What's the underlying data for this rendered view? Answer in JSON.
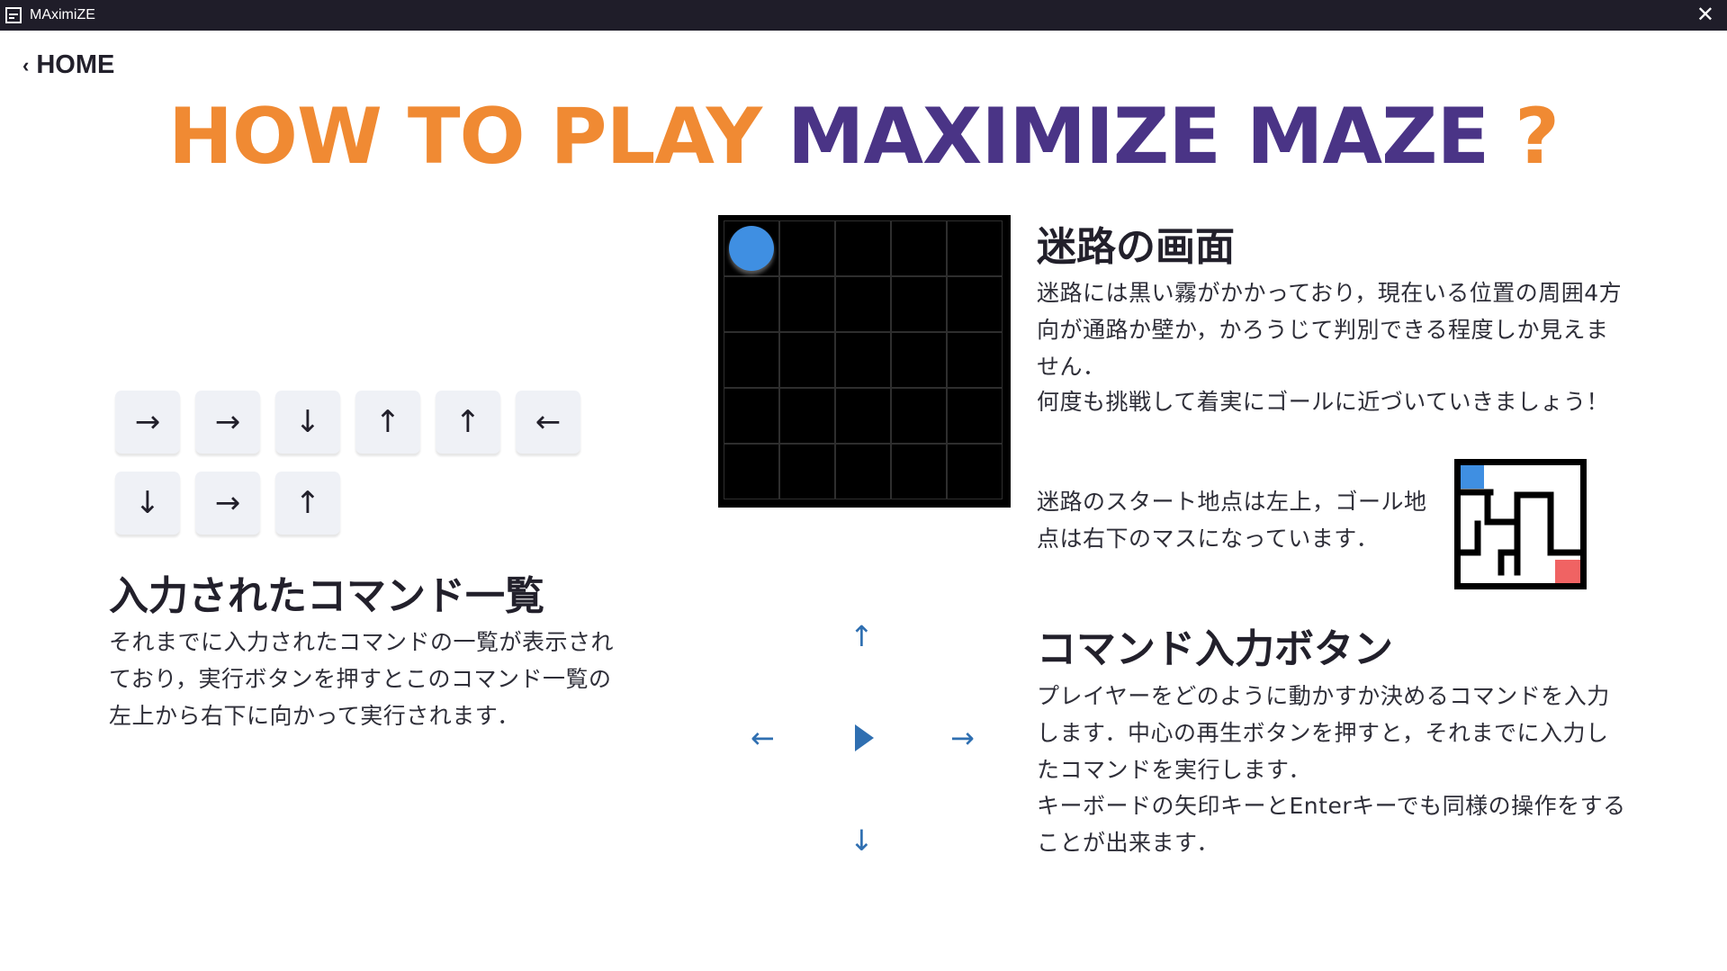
{
  "window": {
    "title": "MAximiZE",
    "close_glyph": "✕"
  },
  "nav": {
    "home_label": "HOME",
    "chevron": "‹"
  },
  "headline": {
    "part1": "HOW TO PLAY ",
    "part2": "MAXIMIZE MAZE",
    "part3": " ?"
  },
  "commands": {
    "title": "入力されたコマンド一覧",
    "description": "それまでに入力されたコマンドの一覧が表示されており，実行ボタンを押すとこのコマンド一覧の左上から右下に向かって実行されます．",
    "items": [
      "→",
      "→",
      "↓",
      "↑",
      "↑",
      "←",
      "↓",
      "→",
      "↑"
    ]
  },
  "maze_screen": {
    "title": "迷路の画面",
    "description": "迷路には黒い霧がかかっており，現在いる位置の周囲4方向が通路か壁か，かろうじて判別できる程度しか見えません．",
    "description2": "何度も挑戦して着実にゴールに近づいていきましょう！",
    "start_goal_note": "迷路のスタート地点は左上，ゴール地点は右下のマスになっています．",
    "grid_size": 5,
    "player_color": "#3f8fe2",
    "start_color": "#3f8fe2",
    "goal_color": "#f06363"
  },
  "command_buttons": {
    "title": "コマンド入力ボタン",
    "description": "プレイヤーをどのように動かすか決めるコマンドを入力します．中心の再生ボタンを押すと，それまでに入力したコマンドを実行します．",
    "description2": "キーボードの矢印キーとEnterキーでも同様の操作をすることが出来ます．",
    "up": "↑",
    "down": "↓",
    "left": "←",
    "right": "→",
    "accent_color": "#2f6fb1"
  },
  "colors": {
    "orange": "#f08a33",
    "purple": "#4a3486",
    "titlebar": "#1f1d29"
  }
}
